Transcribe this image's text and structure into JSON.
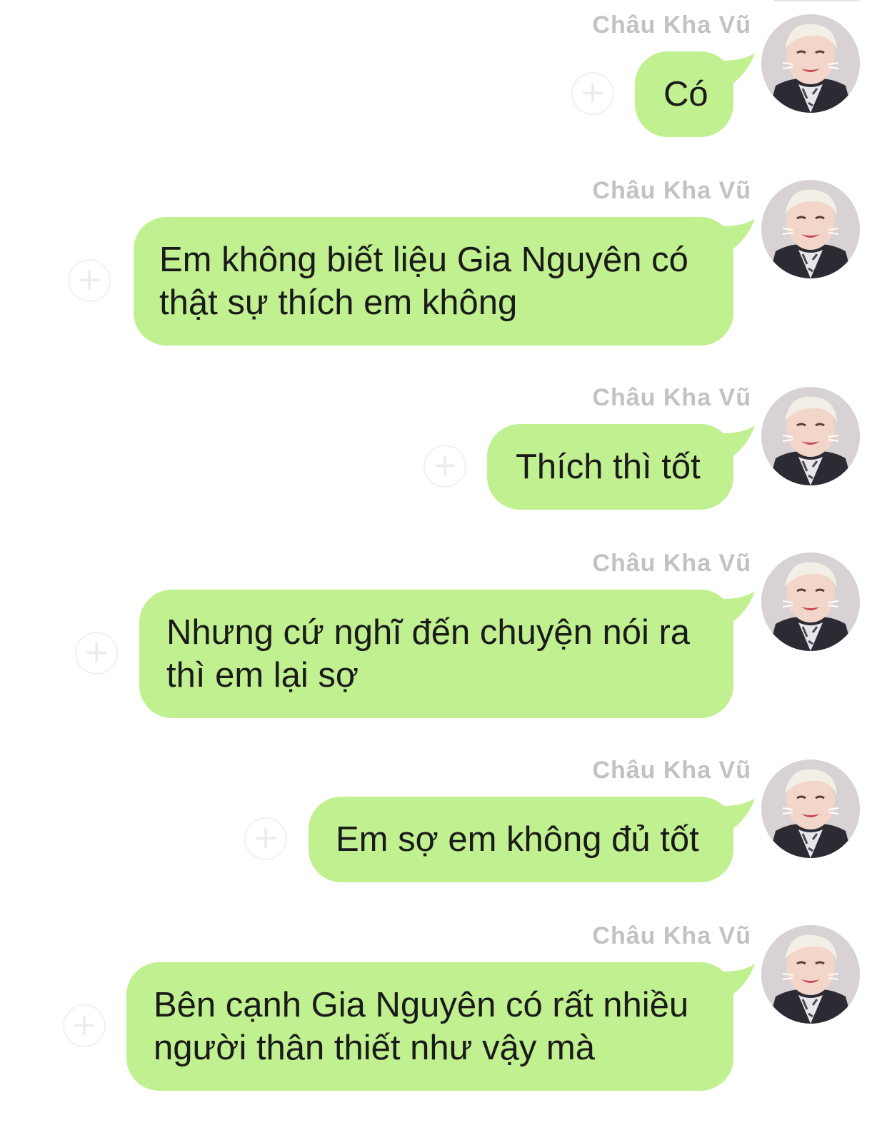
{
  "sender": "Châu Kha Vũ",
  "colors": {
    "bubble": "#c0f08f",
    "sender_name": "#c2c2c2",
    "background": "#ffffff"
  },
  "messages": [
    {
      "sender": "Châu Kha Vũ",
      "text": "Có"
    },
    {
      "sender": "Châu Kha Vũ",
      "text": "Em không biết liệu Gia Nguyên có\nthật sự thích em không"
    },
    {
      "sender": "Châu Kha Vũ",
      "text": "Thích thì tốt"
    },
    {
      "sender": "Châu Kha Vũ",
      "text": "Nhưng cứ nghĩ đến chuyện nói ra\nthì em lại sợ"
    },
    {
      "sender": "Châu Kha Vũ",
      "text": "Em sợ em không đủ tốt"
    },
    {
      "sender": "Châu Kha Vũ",
      "text": "Bên cạnh Gia Nguyên có rất nhiều\nngười thân thiết như vậy mà"
    }
  ],
  "icons": {
    "add_reaction": "add-reaction-icon",
    "avatar": "profile-photo"
  }
}
